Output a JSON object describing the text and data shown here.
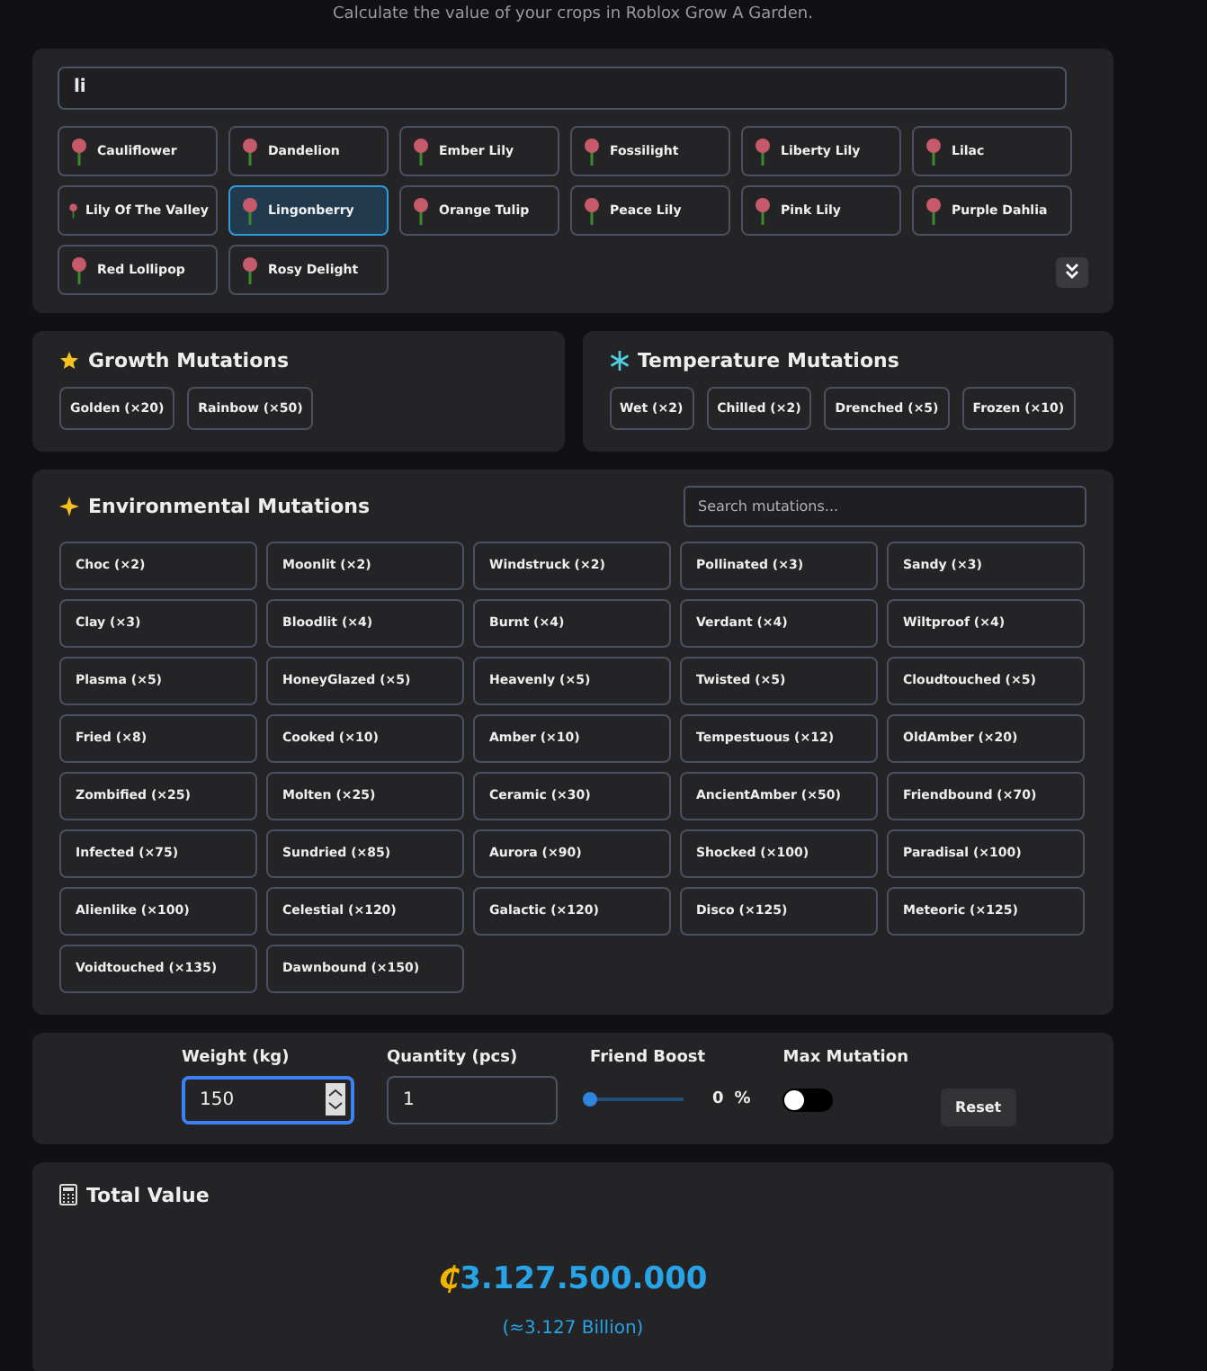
{
  "caption": "Calculate the value of your crops in Roblox Grow A Garden.",
  "crop_search": {
    "value": "li"
  },
  "crops": [
    {
      "name": "Cauliflower",
      "selected": false
    },
    {
      "name": "Dandelion",
      "selected": false
    },
    {
      "name": "Ember Lily",
      "selected": false
    },
    {
      "name": "Fossilight",
      "selected": false
    },
    {
      "name": "Liberty Lily",
      "selected": false
    },
    {
      "name": "Lilac",
      "selected": false
    },
    {
      "name": "Lily Of The Valley",
      "selected": false
    },
    {
      "name": "Lingonberry",
      "selected": true
    },
    {
      "name": "Orange Tulip",
      "selected": false
    },
    {
      "name": "Peace Lily",
      "selected": false
    },
    {
      "name": "Pink Lily",
      "selected": false
    },
    {
      "name": "Purple Dahlia",
      "selected": false
    },
    {
      "name": "Red Lollipop",
      "selected": false
    },
    {
      "name": "Rosy Delight",
      "selected": false
    }
  ],
  "growth": {
    "title": "Growth Mutations",
    "items": [
      {
        "label": "Golden (×20)",
        "selected": false
      },
      {
        "label": "Rainbow (×50)",
        "selected": false
      }
    ]
  },
  "temperature": {
    "title": "Temperature Mutations",
    "items": [
      {
        "label": "Wet (×2)",
        "selected": false
      },
      {
        "label": "Chilled (×2)",
        "selected": false
      },
      {
        "label": "Drenched (×5)",
        "selected": false
      },
      {
        "label": "Frozen (×10)",
        "selected": false
      }
    ]
  },
  "environmental": {
    "title": "Environmental Mutations",
    "search_placeholder": "Search mutations...",
    "items": [
      {
        "label": "Choc (×2)",
        "selected": false
      },
      {
        "label": "Moonlit (×2)",
        "selected": false
      },
      {
        "label": "Windstruck (×2)",
        "selected": false
      },
      {
        "label": "Pollinated (×3)",
        "selected": false
      },
      {
        "label": "Sandy (×3)",
        "selected": false
      },
      {
        "label": "Clay (×3)",
        "selected": false
      },
      {
        "label": "Bloodlit (×4)",
        "selected": false
      },
      {
        "label": "Burnt (×4)",
        "selected": false
      },
      {
        "label": "Verdant (×4)",
        "selected": false
      },
      {
        "label": "Wiltproof (×4)",
        "selected": false
      },
      {
        "label": "Plasma (×5)",
        "selected": false
      },
      {
        "label": "HoneyGlazed (×5)",
        "selected": false
      },
      {
        "label": "Heavenly (×5)",
        "selected": false
      },
      {
        "label": "Twisted (×5)",
        "selected": false
      },
      {
        "label": "Cloudtouched (×5)",
        "selected": false
      },
      {
        "label": "Fried (×8)",
        "selected": false
      },
      {
        "label": "Cooked (×10)",
        "selected": false
      },
      {
        "label": "Amber (×10)",
        "selected": false
      },
      {
        "label": "Tempestuous (×12)",
        "selected": false
      },
      {
        "label": "OldAmber (×20)",
        "selected": false
      },
      {
        "label": "Zombified (×25)",
        "selected": false
      },
      {
        "label": "Molten (×25)",
        "selected": false
      },
      {
        "label": "Ceramic (×30)",
        "selected": false
      },
      {
        "label": "AncientAmber (×50)",
        "selected": false
      },
      {
        "label": "Friendbound (×70)",
        "selected": false
      },
      {
        "label": "Infected (×75)",
        "selected": false
      },
      {
        "label": "Sundried (×85)",
        "selected": false
      },
      {
        "label": "Aurora (×90)",
        "selected": false
      },
      {
        "label": "Shocked (×100)",
        "selected": false
      },
      {
        "label": "Paradisal (×100)",
        "selected": false
      },
      {
        "label": "Alienlike (×100)",
        "selected": false
      },
      {
        "label": "Celestial (×120)",
        "selected": false
      },
      {
        "label": "Galactic (×120)",
        "selected": false
      },
      {
        "label": "Disco (×125)",
        "selected": false
      },
      {
        "label": "Meteoric (×125)",
        "selected": false
      },
      {
        "label": "Voidtouched (×135)",
        "selected": false
      },
      {
        "label": "Dawnbound (×150)",
        "selected": false
      }
    ]
  },
  "controls": {
    "weight": {
      "label": "Weight (kg)",
      "value": "150"
    },
    "quantity": {
      "label": "Quantity (pcs)",
      "value": "1"
    },
    "friend_boost": {
      "label": "Friend Boost",
      "level": 0,
      "value": "0",
      "unit": "%"
    },
    "max_mutation": {
      "label": "Max Mutation",
      "on": false
    },
    "reset": "Reset"
  },
  "total": {
    "title": "Total Value",
    "currency": "₵",
    "amount": "3.127.500.000",
    "approx": "(≈3.127 Billion)"
  }
}
